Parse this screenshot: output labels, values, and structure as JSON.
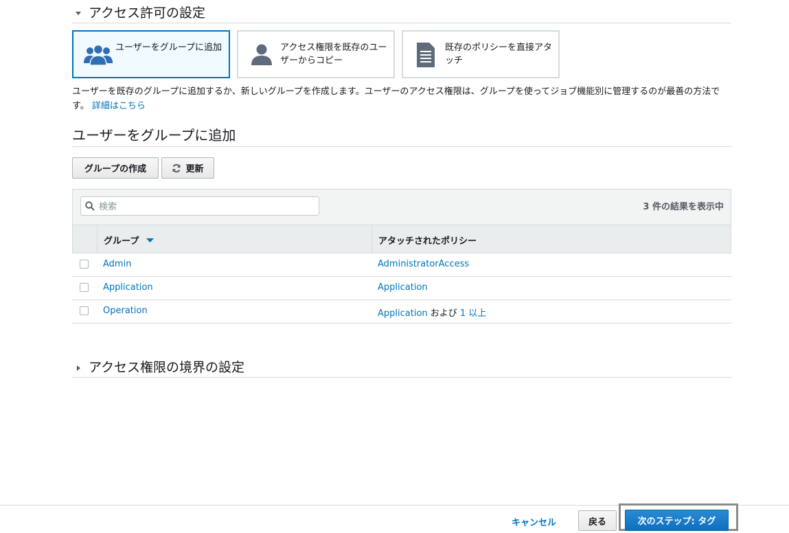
{
  "permissions_section": {
    "title": "アクセス許可の設定",
    "options": [
      {
        "label": "ユーザーをグループに追加",
        "icon": "users-group-icon"
      },
      {
        "label": "アクセス権限を既存のユーザーからコピー",
        "icon": "user-icon"
      },
      {
        "label": "既存のポリシーを直接アタッチ",
        "icon": "document-icon"
      }
    ],
    "description": "ユーザーを既存のグループに追加するか、新しいグループを作成します。ユーザーのアクセス権限は、グループを使ってジョブ機能別に管理するのが最善の方法です。",
    "learn_more": "詳細はこちら"
  },
  "group_section": {
    "title": "ユーザーをグループに追加",
    "create_group_label": "グループの作成",
    "refresh_label": "更新",
    "search_placeholder": "検索",
    "result_count": "3 件の結果を表示中",
    "columns": [
      "グループ",
      "アタッチされたポリシー"
    ],
    "rows": [
      {
        "group": "Admin",
        "policy": "AdministratorAccess",
        "policy_suffix": "",
        "policy_more": ""
      },
      {
        "group": "Application",
        "policy": "Application",
        "policy_suffix": "",
        "policy_more": ""
      },
      {
        "group": "Operation",
        "policy": "Application",
        "policy_suffix": " および ",
        "policy_more": "1 以上"
      }
    ]
  },
  "boundary_section": {
    "title": "アクセス権限の境界の設定"
  },
  "footer": {
    "cancel_label": "キャンセル",
    "back_label": "戻る",
    "next_label": "次のステップ: タグ"
  },
  "colors": {
    "link": "#0073bb",
    "selected_border": "#0073bb",
    "primary_button": "#1a7ecb"
  }
}
